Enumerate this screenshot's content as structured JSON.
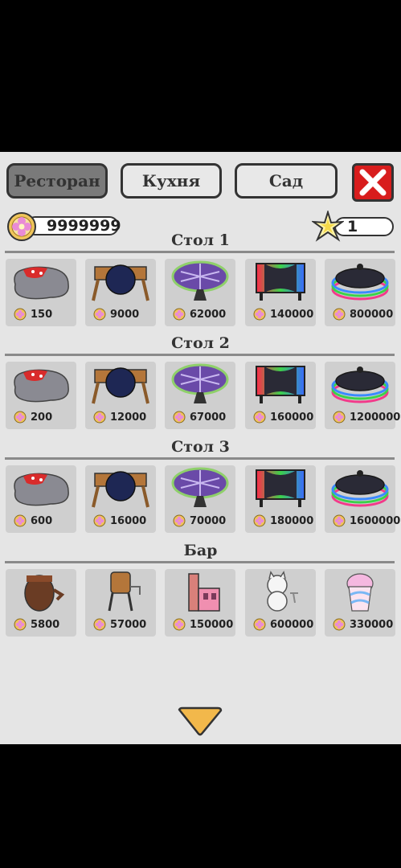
{
  "tabs": [
    {
      "label": "Ресторан",
      "active": true
    },
    {
      "label": "Кухня",
      "active": false
    },
    {
      "label": "Сад",
      "active": false
    }
  ],
  "currency": {
    "coins": "9999999",
    "stars": "1"
  },
  "sections": [
    {
      "title": "Стол 1",
      "items": [
        {
          "icon": "stone-table-icon",
          "price": "150"
        },
        {
          "icon": "wooden-bench-table-icon",
          "price": "9000"
        },
        {
          "icon": "purple-patterned-round-table-icon",
          "price": "62000"
        },
        {
          "icon": "neon-rgb-table-icon",
          "price": "140000"
        },
        {
          "icon": "rainbow-ring-table-icon",
          "price": "800000"
        }
      ]
    },
    {
      "title": "Стол 2",
      "items": [
        {
          "icon": "stone-table-icon",
          "price": "200"
        },
        {
          "icon": "wooden-bench-table-icon",
          "price": "12000"
        },
        {
          "icon": "purple-patterned-round-table-icon",
          "price": "67000"
        },
        {
          "icon": "neon-rgb-table-icon",
          "price": "160000"
        },
        {
          "icon": "rainbow-ring-table-icon",
          "price": "1200000"
        }
      ]
    },
    {
      "title": "Стол 3",
      "items": [
        {
          "icon": "stone-table-icon",
          "price": "600"
        },
        {
          "icon": "wooden-bench-table-icon",
          "price": "16000"
        },
        {
          "icon": "purple-patterned-round-table-icon",
          "price": "70000"
        },
        {
          "icon": "neon-rgb-table-icon",
          "price": "180000"
        },
        {
          "icon": "rainbow-ring-table-icon",
          "price": "1600000"
        }
      ]
    },
    {
      "title": "Бар",
      "items": [
        {
          "icon": "barrel-pot-icon",
          "price": "5800"
        },
        {
          "icon": "water-tower-barrel-icon",
          "price": "57000"
        },
        {
          "icon": "pink-castle-bar-icon",
          "price": "150000"
        },
        {
          "icon": "cat-waiter-icon",
          "price": "600000"
        },
        {
          "icon": "cotton-candy-cup-icon",
          "price": "330000"
        }
      ]
    }
  ],
  "colors": {
    "panel": "#e5e5e5",
    "card": "#cfcfcf",
    "close": "#d81d1d",
    "arrow": "#f2b84b"
  }
}
